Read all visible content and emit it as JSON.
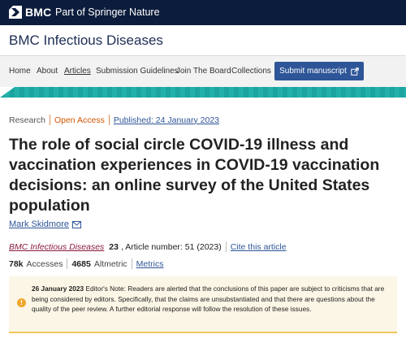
{
  "brand": {
    "name": "BMC",
    "tagline": "Part of Springer Nature",
    "bg_color": "#0c1c3c"
  },
  "journal": {
    "title": "BMC Infectious Diseases"
  },
  "nav": {
    "items": [
      {
        "label": "Home",
        "active": false
      },
      {
        "label": "About",
        "active": false
      },
      {
        "label": "Articles",
        "active": true
      },
      {
        "label": "Submission Guidelines",
        "active": false
      },
      {
        "label": "Join The Board",
        "active": false
      },
      {
        "label": "Collections",
        "active": false
      }
    ],
    "submit_label": "Submit manuscript",
    "submit_icon": "external-link-icon",
    "submit_color": "#2e5597",
    "stripe_color": "#1ba4a0"
  },
  "article": {
    "type": "Research",
    "access": "Open Access",
    "published": "Published: 24 January 2023",
    "title": "The role of social circle COVID-19 illness and vaccination experiences in COVID-19 vaccination decisions: an online survey of the United States population",
    "author": "Mark Skidmore",
    "author_icon": "mail-icon",
    "citation": {
      "journal": "BMC Infectious Diseases",
      "volume": "23",
      "rest": ", Article number: 51 (2023)",
      "cite_link": "Cite this article"
    },
    "metrics": {
      "accesses_value": "78k",
      "accesses_label": "Accesses",
      "altmetric_value": "4685",
      "altmetric_label": "Altmetric",
      "metrics_link": "Metrics"
    }
  },
  "note": {
    "icon": "warning-icon",
    "date": "26 January 2023",
    "text": "Editor's Note: Readers are alerted that the conclusions of this paper are subject to criticisms that are being considered by editors. Specifically, that the claims are unsubstantiated and that there are questions about the quality of the peer review. A further editorial response will follow the resolution of these issues."
  }
}
